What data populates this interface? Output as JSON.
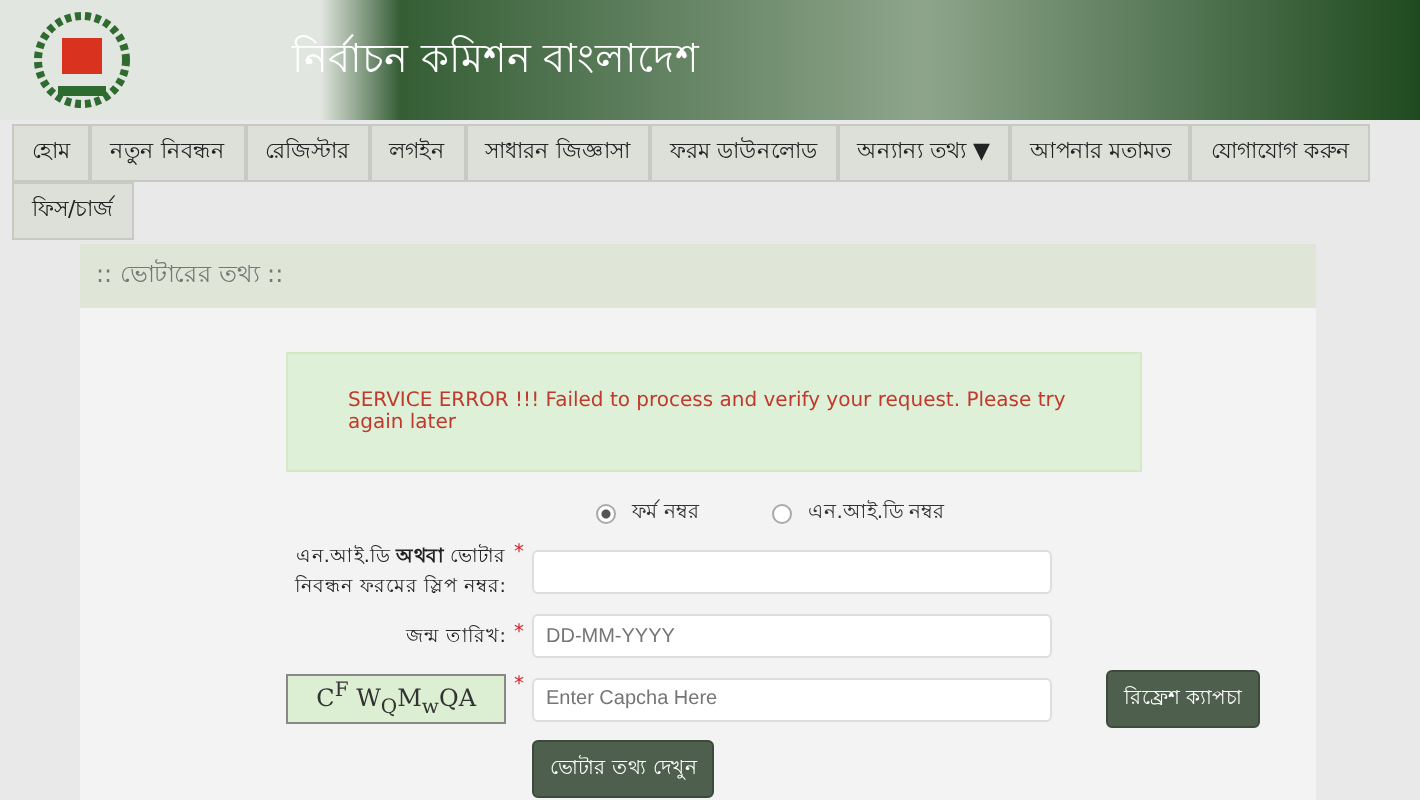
{
  "header": {
    "title": "নির্বাচন কমিশন বাংলাদেশ"
  },
  "nav": [
    {
      "label": "হোম"
    },
    {
      "label": "নতুন নিবন্ধন"
    },
    {
      "label": "রেজিস্টার"
    },
    {
      "label": "লগইন"
    },
    {
      "label": "সাধারন জিজ্ঞাসা"
    },
    {
      "label": "ফরম ডাউনলোড"
    },
    {
      "label": "অন্যান্য তথ্য ▼"
    },
    {
      "label": "আপনার মতামত"
    },
    {
      "label": "যোগাযোগ করুন"
    },
    {
      "label": "ফিস/চার্জ"
    }
  ],
  "panel": {
    "title": ":: ভোটারের তথ্য ::",
    "error": "SERVICE ERROR !!! Failed to process and verify your request. Please try again later",
    "radios": [
      {
        "label": "ফর্ম নম্বর",
        "selected": true
      },
      {
        "label": "এন.আই.ডি নম্বর",
        "selected": false
      }
    ],
    "fields": [
      {
        "kind": "text",
        "label": "এন.আই.ডি **অথবা** ভোটার নিবন্ধন ফরমের স্লিপ নম্বর:",
        "required": "*"
      },
      {
        "kind": "text",
        "label": "জন্ম তারিখ:",
        "required": "*",
        "placeholder": "DD-MM-YYYY"
      },
      {
        "kind": "captcha",
        "captcha": "C$^{F}$ W$_{Q}$M$_{w}$QA",
        "required": "*",
        "placeholder": "Enter Capcha Here",
        "button": "রিফ্রেশ ক্যাপচা"
      }
    ],
    "submit": "ভোটার তথ্য দেখুন"
  }
}
